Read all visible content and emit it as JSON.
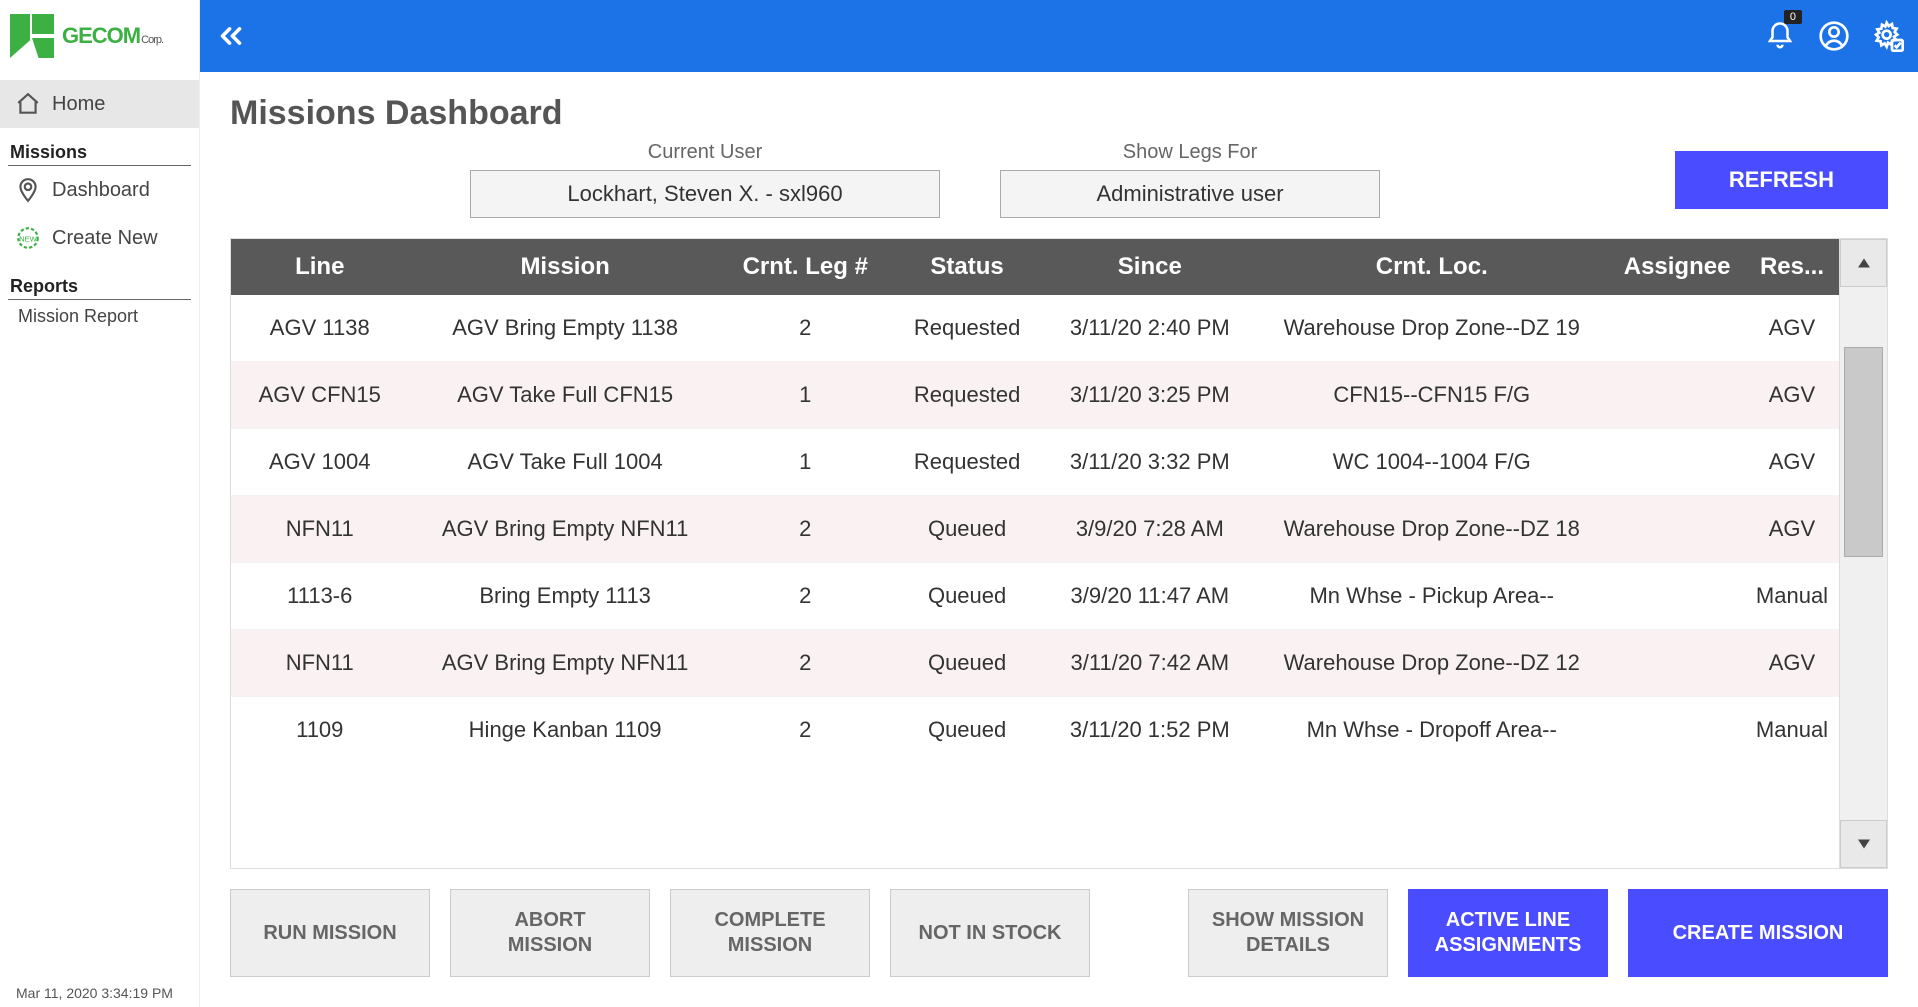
{
  "brand": {
    "name": "GECOM",
    "suffix": "Corp."
  },
  "topbar": {
    "notification_count": "0"
  },
  "sidebar": {
    "home": "Home",
    "missions_header": "Missions",
    "dashboard": "Dashboard",
    "create_new": "Create New",
    "reports_header": "Reports",
    "mission_report": "Mission Report"
  },
  "footer_time": "Mar 11, 2020 3:34:19 PM",
  "page": {
    "title": "Missions Dashboard",
    "current_user_label": "Current User",
    "current_user": "Lockhart, Steven X. - sxl960",
    "show_legs_label": "Show Legs For",
    "show_legs": "Administrative user",
    "refresh": "REFRESH"
  },
  "table": {
    "headers": {
      "line": "Line",
      "mission": "Mission",
      "crnt_leg": "Crnt. Leg #",
      "status": "Status",
      "since": "Since",
      "crnt_loc": "Crnt. Loc.",
      "assignee": "Assignee",
      "res": "Res..."
    },
    "rows": [
      {
        "line": "AGV 1138",
        "mission": "AGV Bring Empty 1138",
        "leg": "2",
        "status": "Requested",
        "since": "3/11/20 2:40 PM",
        "loc": "Warehouse Drop Zone--DZ 19",
        "assignee": "",
        "res": "AGV"
      },
      {
        "line": "AGV CFN15",
        "mission": "AGV Take Full CFN15",
        "leg": "1",
        "status": "Requested",
        "since": "3/11/20 3:25 PM",
        "loc": "CFN15--CFN15 F/G",
        "assignee": "",
        "res": "AGV"
      },
      {
        "line": "AGV 1004",
        "mission": "AGV Take Full 1004",
        "leg": "1",
        "status": "Requested",
        "since": "3/11/20 3:32 PM",
        "loc": "WC 1004--1004 F/G",
        "assignee": "",
        "res": "AGV"
      },
      {
        "line": "NFN11",
        "mission": "AGV Bring Empty NFN11",
        "leg": "2",
        "status": "Queued",
        "since": "3/9/20 7:28 AM",
        "loc": "Warehouse Drop Zone--DZ 18",
        "assignee": "",
        "res": "AGV"
      },
      {
        "line": "1113-6",
        "mission": "Bring Empty 1113",
        "leg": "2",
        "status": "Queued",
        "since": "3/9/20 11:47 AM",
        "loc": "Mn Whse - Pickup Area--",
        "assignee": "",
        "res": "Manual"
      },
      {
        "line": "NFN11",
        "mission": "AGV Bring Empty NFN11",
        "leg": "2",
        "status": "Queued",
        "since": "3/11/20 7:42 AM",
        "loc": "Warehouse Drop Zone--DZ 12",
        "assignee": "",
        "res": "AGV"
      },
      {
        "line": "1109",
        "mission": "Hinge Kanban 1109",
        "leg": "2",
        "status": "Queued",
        "since": "3/11/20 1:52 PM",
        "loc": "Mn Whse - Dropoff Area--",
        "assignee": "",
        "res": "Manual"
      }
    ]
  },
  "buttons": {
    "run": "RUN MISSION",
    "abort": "ABORT MISSION",
    "complete": "COMPLETE MISSION",
    "not_in_stock": "NOT IN STOCK",
    "show_details": "SHOW MISSION DETAILS",
    "active_line": "ACTIVE LINE ASSIGNMENTS",
    "create": "CREATE MISSION"
  }
}
